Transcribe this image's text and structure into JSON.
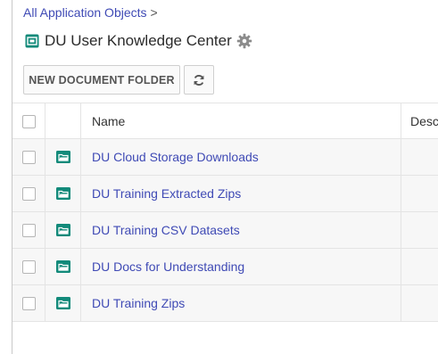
{
  "breadcrumb": {
    "link_label": "All Application Objects",
    "separator": ">"
  },
  "page": {
    "title": "DU User Knowledge Center",
    "title_icon": "folder-tree-icon",
    "settings_icon": "gear-icon"
  },
  "toolbar": {
    "new_folder_label": "NEW DOCUMENT FOLDER",
    "refresh_icon": "refresh-icon"
  },
  "table": {
    "columns": [
      "Name",
      "Desc"
    ],
    "rows": [
      {
        "name": "DU Cloud Storage Downloads",
        "icon": "folder-icon"
      },
      {
        "name": "DU Training Extracted Zips",
        "icon": "folder-icon"
      },
      {
        "name": "DU Training CSV Datasets",
        "icon": "folder-icon"
      },
      {
        "name": "DU Docs for Understanding",
        "icon": "folder-icon"
      },
      {
        "name": "DU Training Zips",
        "icon": "folder-icon"
      }
    ]
  },
  "colors": {
    "link": "#3f4ab5",
    "folder_icon": "#128a7a",
    "border": "#e4e4e4"
  }
}
